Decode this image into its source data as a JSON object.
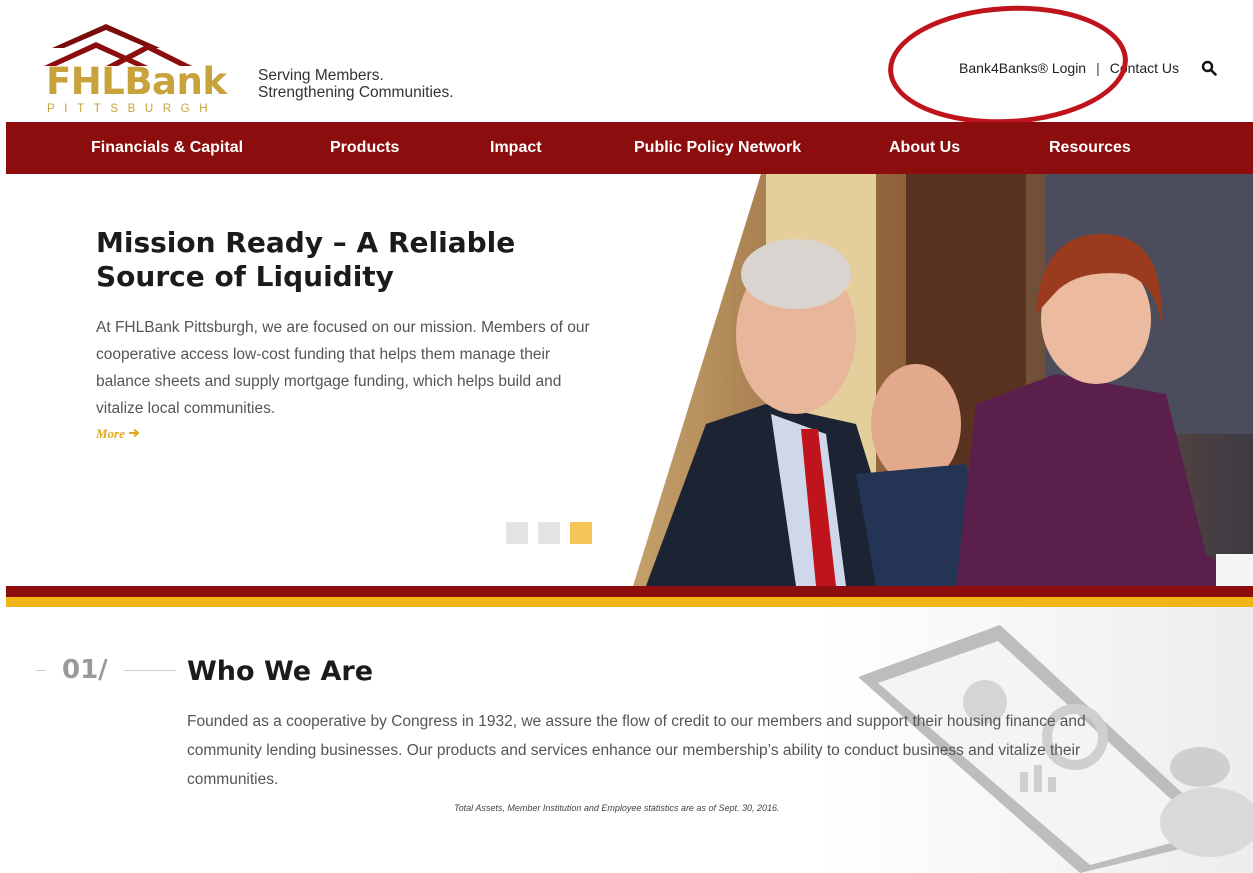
{
  "colors": {
    "brand_red": "#8c0d0d",
    "gold": "#c8a23a",
    "stripe_gold": "#f0b617",
    "accent_more": "#e0a81a",
    "annotation_red": "#c0141c"
  },
  "logo": {
    "name_part1": "FHL",
    "name_part2": "Bank",
    "subtitle": "PITTSBURGH"
  },
  "tagline": {
    "line1": "Serving Members.",
    "line2": "Strengthening Communities."
  },
  "top_links": {
    "login": "Bank4Banks® Login",
    "separator": "|",
    "contact": "Contact Us",
    "search_icon": "search-icon"
  },
  "nav": {
    "items": [
      {
        "label": "Financials & Capital"
      },
      {
        "label": "Products"
      },
      {
        "label": "Impact"
      },
      {
        "label": "Public Policy Network"
      },
      {
        "label": "About Us"
      },
      {
        "label": "Resources"
      }
    ]
  },
  "hero": {
    "title": "Mission Ready – A Reliable Source of Liquidity",
    "body": "At FHLBank Pittsburgh, we are focused on our mission. Members of our cooperative access low-cost funding that helps them manage their balance sheets and supply mortgage funding, which helps build and vitalize local communities.",
    "more": "More",
    "more_icon": "arrow-right-icon",
    "slides": 3,
    "active_slide": 3
  },
  "who_we_are": {
    "number": "01/",
    "title": "Who We Are",
    "body": "Founded as a cooperative by Congress in 1932, we assure the flow of credit to our members and support their housing finance and community lending businesses. Our products and services enhance our membership’s ability to conduct business and vitalize their communities.",
    "footnote": "Total Assets, Member Institution and Employee statistics are as of Sept. 30, 2016."
  }
}
